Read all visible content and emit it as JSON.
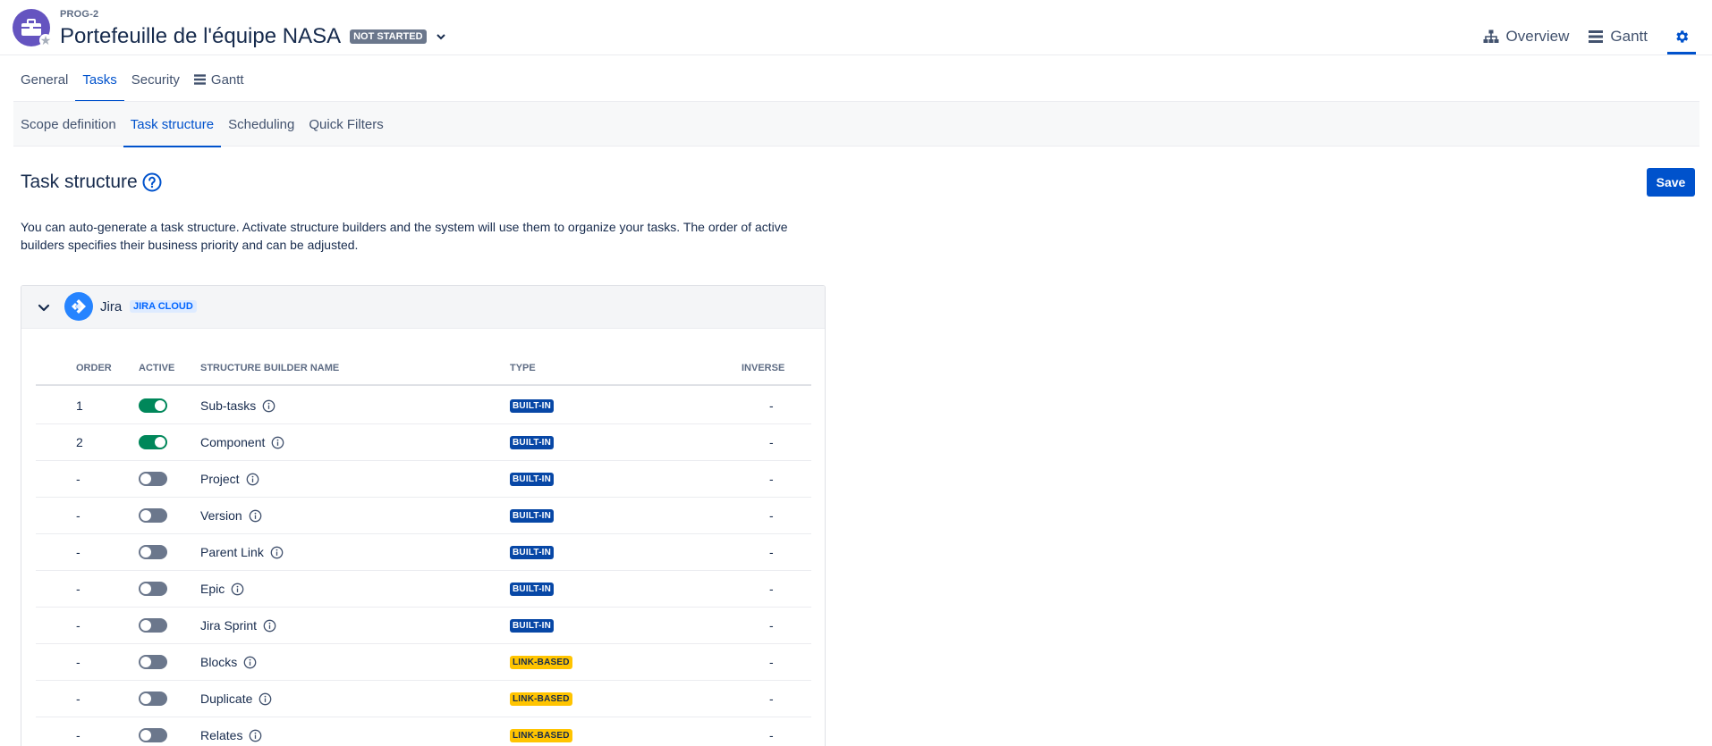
{
  "header": {
    "project_key": "PROG-2",
    "title": "Portefeuille de l'équipe NASA",
    "status": "NOT STARTED",
    "overview_label": "Overview",
    "gantt_label": "Gantt"
  },
  "primary_tabs": [
    {
      "label": "General",
      "active": false
    },
    {
      "label": "Tasks",
      "active": true
    },
    {
      "label": "Security",
      "active": false
    },
    {
      "label": "Gantt",
      "active": false
    }
  ],
  "secondary_tabs": [
    {
      "label": "Scope definition",
      "active": false
    },
    {
      "label": "Task structure",
      "active": true
    },
    {
      "label": "Scheduling",
      "active": false
    },
    {
      "label": "Quick Filters",
      "active": false
    }
  ],
  "page": {
    "title": "Task structure",
    "save_label": "Save",
    "description": "You can auto-generate a task structure. Activate structure builders and the system will use them to organize your tasks. The order of active builders specifies their business priority and can be adjusted."
  },
  "source": {
    "name": "Jira",
    "badge": "JIRA CLOUD"
  },
  "table": {
    "columns": {
      "order": "ORDER",
      "active": "ACTIVE",
      "name": "STRUCTURE BUILDER NAME",
      "type": "TYPE",
      "inverse": "INVERSE"
    },
    "rows": [
      {
        "order": "1",
        "active": true,
        "name": "Sub-tasks",
        "type": "BUILT-IN",
        "type_kind": "builtin",
        "inverse": "-"
      },
      {
        "order": "2",
        "active": true,
        "name": "Component",
        "type": "BUILT-IN",
        "type_kind": "builtin",
        "inverse": "-"
      },
      {
        "order": "-",
        "active": false,
        "name": "Project",
        "type": "BUILT-IN",
        "type_kind": "builtin",
        "inverse": "-"
      },
      {
        "order": "-",
        "active": false,
        "name": "Version",
        "type": "BUILT-IN",
        "type_kind": "builtin",
        "inverse": "-"
      },
      {
        "order": "-",
        "active": false,
        "name": "Parent Link",
        "type": "BUILT-IN",
        "type_kind": "builtin",
        "inverse": "-"
      },
      {
        "order": "-",
        "active": false,
        "name": "Epic",
        "type": "BUILT-IN",
        "type_kind": "builtin",
        "inverse": "-"
      },
      {
        "order": "-",
        "active": false,
        "name": "Jira Sprint",
        "type": "BUILT-IN",
        "type_kind": "builtin",
        "inverse": "-"
      },
      {
        "order": "-",
        "active": false,
        "name": "Blocks",
        "type": "LINK-BASED",
        "type_kind": "link",
        "inverse": "-"
      },
      {
        "order": "-",
        "active": false,
        "name": "Duplicate",
        "type": "LINK-BASED",
        "type_kind": "link",
        "inverse": "-"
      },
      {
        "order": "-",
        "active": false,
        "name": "Relates",
        "type": "LINK-BASED",
        "type_kind": "link",
        "inverse": "-"
      }
    ]
  },
  "colors": {
    "primary": "#0052cc",
    "toggle_on": "#00875a",
    "toggle_off": "#6b778c",
    "built_in": "#0747a6",
    "link_based": "#ffc400",
    "avatar": "#6554c0"
  },
  "icons": {
    "avatar": "briefcase-icon",
    "favorite": "star-icon",
    "status_menu": "chevron-down-icon",
    "overview": "hierarchy-icon",
    "gantt": "gantt-icon",
    "settings": "gear-icon",
    "help": "question-circle-icon",
    "collapse": "chevron-down-icon",
    "jira": "jira-logo-icon",
    "info": "info-circle-icon"
  }
}
